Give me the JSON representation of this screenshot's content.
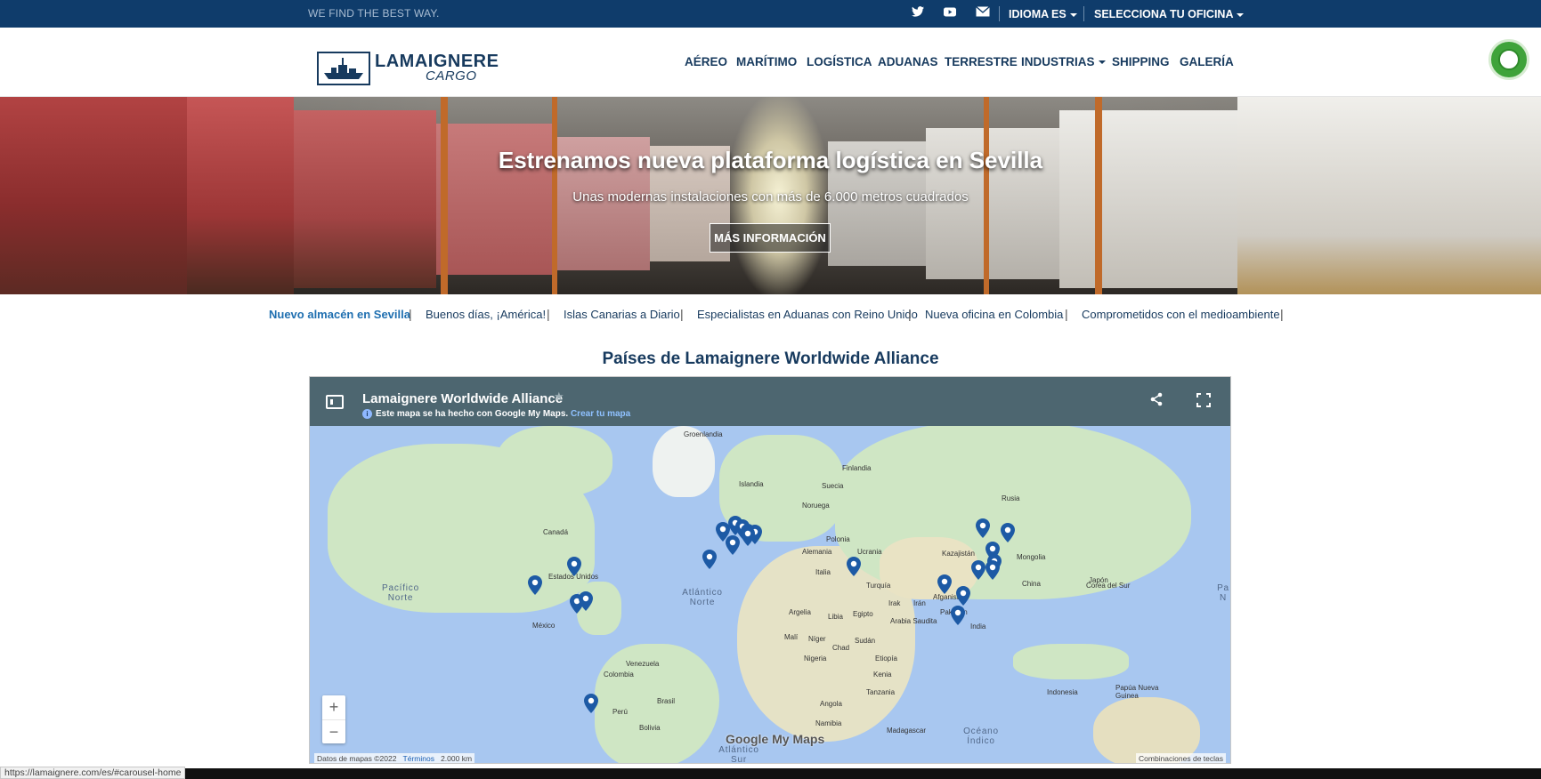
{
  "topbar": {
    "tagline": "WE FIND THE BEST WAY.",
    "idioma_label": "IDIOMA",
    "language": "ES",
    "office_label": "SELECCIONA TU OFICINA"
  },
  "header": {
    "logo_line1": "LAMAIGNERE",
    "logo_line2": "CARGO",
    "nav": [
      "AÉREO",
      "MARÍTIMO",
      "LOGÍSTICA",
      "ADUANAS",
      "TERRESTRE",
      "INDUSTRIAS",
      "SHIPPING",
      "GALERÍA"
    ]
  },
  "hero": {
    "title": "Estrenamos nueva plataforma logística en Sevilla",
    "subtitle": "Unas modernas instalaciones con más de 6.000 metros cuadrados",
    "button": "MÁS INFORMACIÓN"
  },
  "carousel_links": [
    "Nuevo almacén en Sevilla",
    "Buenos días, ¡América!",
    "Islas Canarias a Diario",
    "Especialistas en Aduanas con Reino Unido",
    "Nueva oficina en Colombia",
    "Comprometidos con el medioambiente"
  ],
  "section_title": "Países de Lamaignere Worldwide Alliance",
  "map": {
    "title": "Lamaignere Worldwide Alliance",
    "info_text": "Este mapa se ha hecho con Google My Maps.",
    "info_link": "Crear tu mapa",
    "zoom_in": "+",
    "zoom_out": "−",
    "brand": "Google My Maps",
    "attribution": "Datos de mapas ©2022",
    "terms": "Términos",
    "scale": "2.000 km",
    "shortcuts": "Combinaciones de teclas",
    "labels": {
      "groenlandia": "Groenlandia",
      "islandia": "Islandia",
      "finlandia": "Finlandia",
      "suecia": "Suecia",
      "noruega": "Noruega",
      "canada": "Canadá",
      "estados_unidos": "Estados Unidos",
      "mexico": "México",
      "venezuela": "Venezuela",
      "colombia": "Colombia",
      "peru": "Perú",
      "brasil": "Brasil",
      "bolivia": "Bolivia",
      "alemania": "Alemania",
      "polonia": "Polonia",
      "ucrania": "Ucrania",
      "italia": "Italia",
      "rusia": "Rusia",
      "kazajistan": "Kazajistán",
      "mongolia": "Mongolia",
      "china": "China",
      "japon": "Japón",
      "corea_del_sur": "Corea del Sur",
      "turquia": "Turquía",
      "irak": "Irak",
      "iran": "Irán",
      "afganistan": "Afganistán",
      "pakistan": "Pakistán",
      "india": "India",
      "arabia_saudita": "Arabia Saudita",
      "argelia": "Argelia",
      "libia": "Libia",
      "egipto": "Egipto",
      "mali": "Malí",
      "niger": "Níger",
      "chad": "Chad",
      "sudan": "Sudán",
      "nigeria": "Nigeria",
      "etiopia": "Etiopía",
      "kenia": "Kenia",
      "tanzania": "Tanzania",
      "angola": "Angola",
      "namibia": "Namibia",
      "madagascar": "Madagascar",
      "indonesia": "Indonesia",
      "papua": "Papúa Nueva Guinea",
      "pacifico_norte": "Pacífico Norte",
      "atlantico_norte": "Atlántico Norte",
      "atlantico_sur": "Atlántico Sur",
      "oceano_indico": "Océano Índico",
      "pacifico_right": "Pa N"
    }
  },
  "statusbar": "https://lamaignere.com/es/#carousel-home",
  "colors": {
    "topbar": "#0f3c6b",
    "navy": "#173a5e",
    "pin": "#1d5aa5",
    "map_header": "#4d6670"
  }
}
